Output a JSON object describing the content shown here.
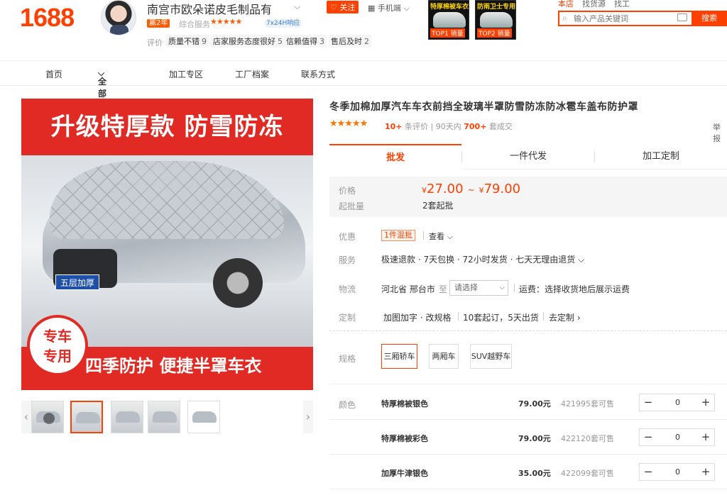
{
  "brand": {
    "logo": "1688"
  },
  "shop": {
    "name": "南宫市欧朵诺皮毛制品有",
    "years_badge": "赢2年",
    "service_label": "综合服务",
    "service_stars": "★★★★★",
    "badge_24h": "7x24H响应",
    "eval_label": "评价",
    "eval_tags": [
      {
        "label": "质量不错",
        "count": "9"
      },
      {
        "label": "店家服务态度很好",
        "count": "5"
      },
      {
        "label": "信赖值得",
        "count": "3"
      },
      {
        "label": "售后及时",
        "count": "2"
      }
    ],
    "follow_label": "关注",
    "mobile_label": "手机端"
  },
  "top_promos": [
    {
      "title": "特厚棉被车衣",
      "rank": "TOP1 销量"
    },
    {
      "title": "防雨卫士专用车衣",
      "rank": "TOP2 销量"
    }
  ],
  "search": {
    "tabs": [
      "本店",
      "找货源",
      "找工"
    ],
    "placeholder": "输入产品关键词",
    "button": "搜索"
  },
  "nav": {
    "items": [
      "首页",
      "全部商品",
      "加工专区",
      "工厂档案",
      "联系方式"
    ]
  },
  "gallery": {
    "banner": "升级特厚款 防雪防冻",
    "plate": "五层加厚",
    "circle_line1": "专车",
    "circle_line2": "专用",
    "slogan": "四季防护 便捷半罩车衣",
    "thumb_count": 5,
    "selected_thumb": 2
  },
  "product": {
    "title": "冬季加棉加厚汽车车衣前挡全玻璃半罩防雪防冻防冰雹车盖布防护罩",
    "rating_stars": "★★★★★",
    "review_count": "10+",
    "review_label": "条评价",
    "sold_prefix": "90天内",
    "sold_count": "700+",
    "sold_suffix": "套成交",
    "report": "举报"
  },
  "tabs": [
    "批发",
    "一件代发",
    "加工定制"
  ],
  "price": {
    "label": "价格",
    "currency": "¥",
    "low": "27.00",
    "tilde": "~",
    "high": "79.00",
    "moq_label": "起批量",
    "moq": "2套起批"
  },
  "offers": {
    "label": "优惠",
    "tag": "1件混批",
    "view": "查看"
  },
  "service": {
    "label": "服务",
    "text": "极速退款 · 7天包换 · 72小时发货 · 七天无理由退货"
  },
  "logistics": {
    "label": "物流",
    "origin": "河北省 邢台市",
    "to": "至",
    "select_placeholder": "请选择",
    "freight": "运费：选择收货地后展示运费"
  },
  "custom": {
    "label": "定制",
    "options": "加图加字 · 改规格",
    "terms": "10套起订，5天出货",
    "link": "去定制"
  },
  "spec": {
    "label": "规格",
    "options": [
      "三厢轿车",
      "两厢车",
      "SUV越野车"
    ],
    "selected": 0
  },
  "color": {
    "label": "颜色",
    "skus": [
      {
        "name": "特厚棉被银色",
        "price": "79.00元",
        "stock": "421995套可售",
        "qty": "0"
      },
      {
        "name": "特厚棉被彩色",
        "price": "79.00元",
        "stock": "422120套可售",
        "qty": "0"
      },
      {
        "name": "加厚牛津银色",
        "price": "35.00元",
        "stock": "422099套可售",
        "qty": "0"
      }
    ]
  }
}
